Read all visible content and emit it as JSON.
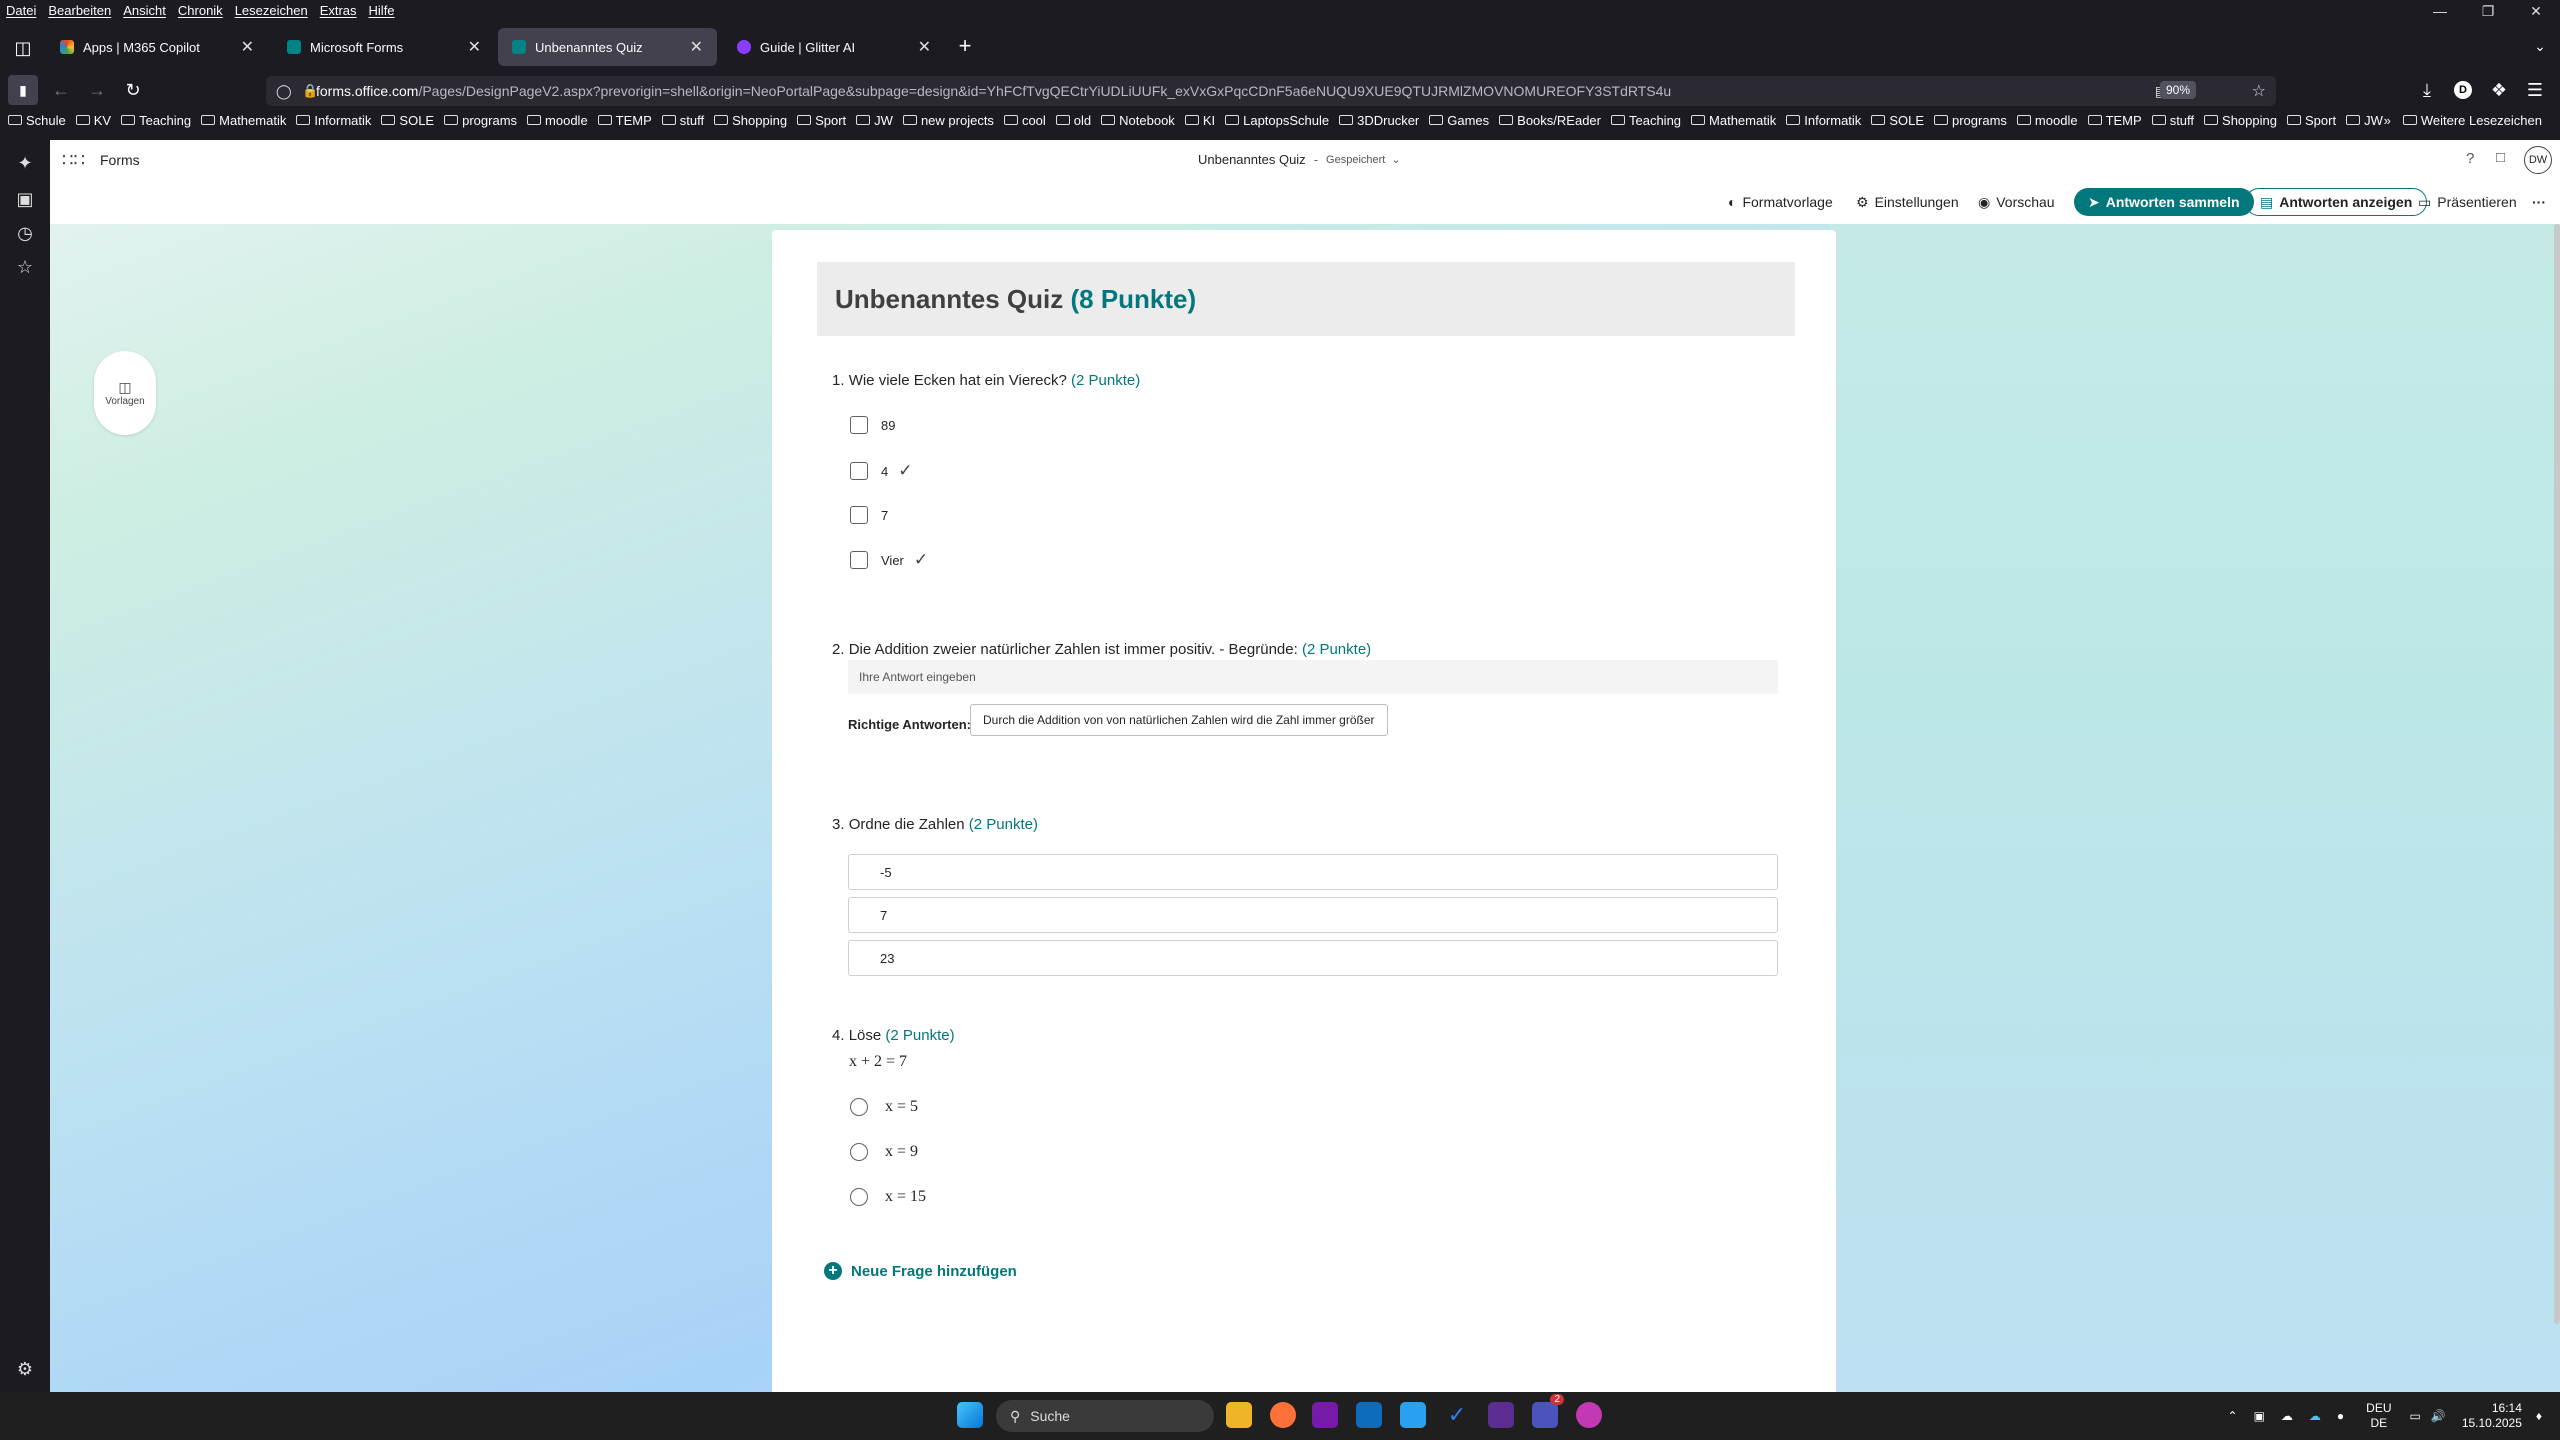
{
  "menubar": {
    "items": [
      "Datei",
      "Bearbeiten",
      "Ansicht",
      "Chronik",
      "Lesezeichen",
      "Extras",
      "Hilfe"
    ]
  },
  "tabs": [
    {
      "title": "Apps | M365 Copilot",
      "icon": "m365-icon",
      "active": false
    },
    {
      "title": "Microsoft Forms",
      "icon": "forms-icon",
      "active": false
    },
    {
      "title": "Unbenanntes Quiz",
      "icon": "forms-icon",
      "active": true
    },
    {
      "title": "Guide | Glitter AI",
      "icon": "glitter-icon",
      "active": false
    }
  ],
  "navbar": {
    "url_domain": "forms.office.com",
    "url_path": "/Pages/DesignPageV2.aspx?prevorigin=shell&origin=NeoPortalPage&subpage=design&id=YhFCfTvgQECtrYiUDLiUUFk_exVxGxPqcCDnF5a6eNUQU9XUE9QTUJRMlZMOVNOMUREOFY3STdRTS4u",
    "zoom": "90%",
    "profile_letter": "D"
  },
  "bookmarks": [
    "Schule",
    "KV",
    "Teaching",
    "Mathematik",
    "Informatik",
    "SOLE",
    "programs",
    "moodle",
    "TEMP",
    "stuff",
    "Shopping",
    "Sport",
    "JW",
    "new projects",
    "cool",
    "old",
    "Notebook",
    "KI",
    "LaptopsSchule",
    "3DDrucker",
    "Games",
    "Books/REader",
    "Teaching",
    "Mathematik",
    "Informatik",
    "SOLE",
    "programs",
    "moodle",
    "TEMP",
    "stuff",
    "Shopping",
    "Sport",
    "JW"
  ],
  "bookmarks_more": "Weitere Lesezeichen",
  "forms_app": {
    "app_name": "Forms",
    "doc_title": "Unbenanntes Quiz",
    "save_status": "Gespeichert",
    "user_initials": "DW",
    "commands": {
      "theme": "Formatvorlage",
      "settings": "Einstellungen",
      "preview": "Vorschau",
      "collect": "Antworten sammeln",
      "view_responses": "Antworten anzeigen",
      "present": "Präsentieren",
      "more": "···"
    },
    "templates_label": "Vorlagen"
  },
  "quiz": {
    "title": "Unbenanntes Quiz",
    "total_points": "(8 Punkte)",
    "questions": [
      {
        "number": "1.",
        "text": "Wie viele Ecken hat ein Viereck?",
        "points": "(2 Punkte)",
        "options": [
          {
            "label": "89",
            "correct": false
          },
          {
            "label": "4",
            "correct": true
          },
          {
            "label": "7",
            "correct": false
          },
          {
            "label": "Vier",
            "correct": true
          }
        ]
      },
      {
        "number": "2.",
        "text": "Die Addition zweier natürlicher Zahlen ist immer positiv. - Begründe:",
        "points": "(2 Punkte)",
        "placeholder": "Ihre Antwort eingeben",
        "correct_label": "Richtige Antworten:",
        "correct_answer": "Durch die Addition von von natürlichen Zahlen wird die Zahl immer größer"
      },
      {
        "number": "3.",
        "text": "Ordne die Zahlen",
        "points": "(2 Punkte)",
        "items": [
          "-5",
          "7",
          "23"
        ]
      },
      {
        "number": "4.",
        "text": "Löse",
        "points": "(2 Punkte)",
        "equation": "x + 2 = 7",
        "options": [
          "x = 5",
          "x = 9",
          "x = 15"
        ]
      }
    ],
    "add_question": "Neue Frage hinzufügen"
  },
  "taskbar": {
    "search": "Suche",
    "lang_top": "DEU",
    "lang_bottom": "DE",
    "time": "16:14",
    "date": "15.10.2025",
    "badge": "2"
  },
  "colors": {
    "accent": "#03787c",
    "browser_bg": "#1c1b22",
    "active_tab": "#42414d"
  }
}
